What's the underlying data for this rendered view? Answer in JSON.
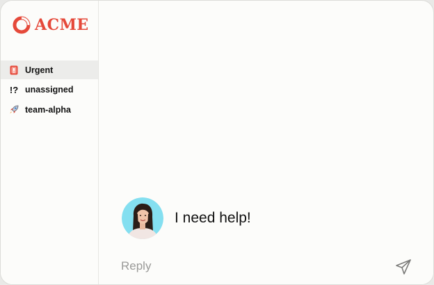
{
  "brand": {
    "name": "ACME",
    "color": "#e5493a"
  },
  "sidebar": {
    "items": [
      {
        "label": "Urgent",
        "icon": "urgent-badge-icon",
        "active": true
      },
      {
        "label": "unassigned",
        "icon": "exclamation-question-icon",
        "active": false
      },
      {
        "label": "team-alpha",
        "icon": "rocket-icon",
        "active": false
      }
    ]
  },
  "chat": {
    "message": "I need help!",
    "avatar_bg": "#84dff0"
  },
  "reply": {
    "placeholder": "Reply",
    "send_icon": "send-icon"
  }
}
